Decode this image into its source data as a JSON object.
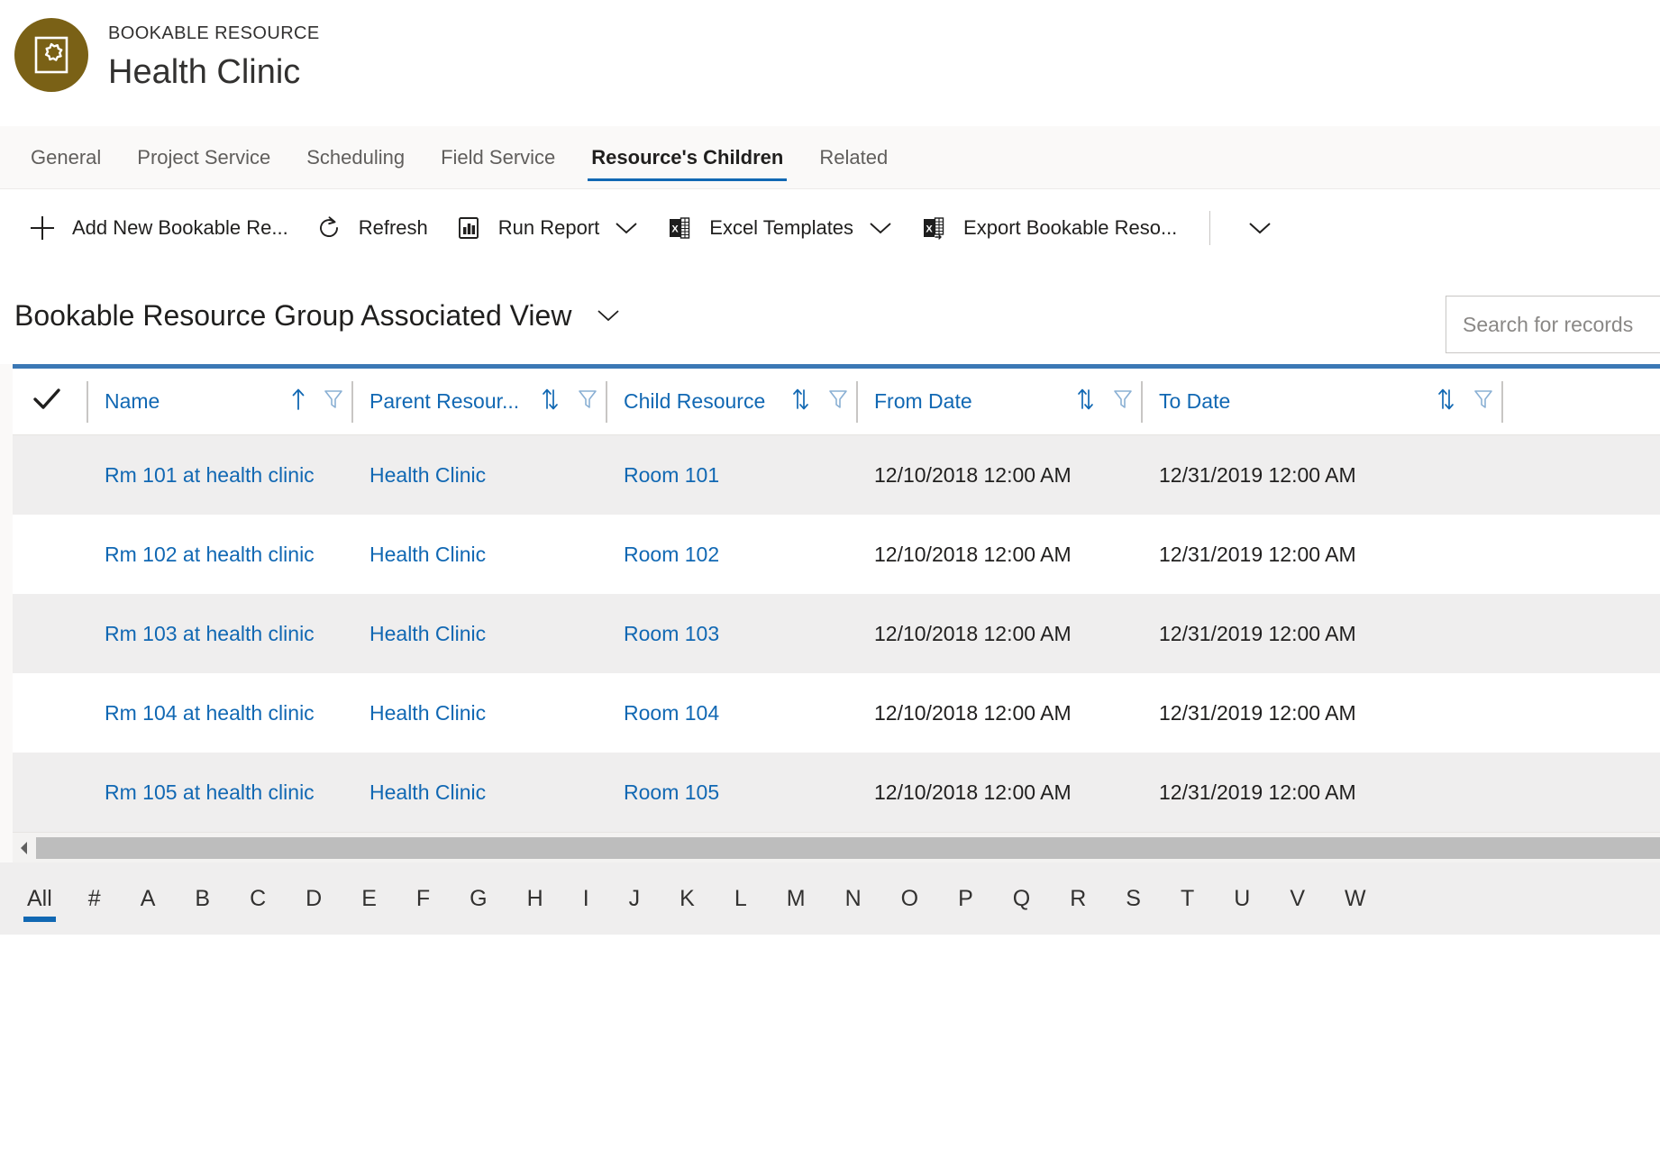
{
  "record": {
    "entity_label": "BOOKABLE RESOURCE",
    "title": "Health Clinic",
    "avatar_icon": "bookable-resource-icon",
    "avatar_color": "#7a6116"
  },
  "tabs": [
    {
      "label": "General",
      "active": false
    },
    {
      "label": "Project Service",
      "active": false
    },
    {
      "label": "Scheduling",
      "active": false
    },
    {
      "label": "Field Service",
      "active": false
    },
    {
      "label": "Resource's Children",
      "active": true
    },
    {
      "label": "Related",
      "active": false
    }
  ],
  "commandbar": {
    "items": [
      {
        "label": "Add New Bookable Re...",
        "icon": "plus-icon",
        "caret": false
      },
      {
        "label": "Refresh",
        "icon": "refresh-icon",
        "caret": false
      },
      {
        "label": "Run Report",
        "icon": "report-chart-icon",
        "caret": true
      },
      {
        "label": "Excel Templates",
        "icon": "excel-icon",
        "caret": true
      },
      {
        "label": "Export Bookable Reso...",
        "icon": "excel-export-icon",
        "caret": false
      }
    ],
    "overflow_icon": "chevron-down-icon"
  },
  "view": {
    "title": "Bookable Resource Group Associated View",
    "selector_icon": "chevron-down-icon"
  },
  "search": {
    "placeholder": "Search for records",
    "value": ""
  },
  "grid": {
    "accent_color": "#3b78b5",
    "link_color": "#1168b3",
    "select_all_icon": "checkmark-icon",
    "columns": [
      {
        "key": "name",
        "label": "Name",
        "sort": "asc",
        "filter": true
      },
      {
        "key": "parent",
        "label": "Parent Resour...",
        "sort": "none",
        "filter": true
      },
      {
        "key": "child",
        "label": "Child Resource",
        "sort": "none",
        "filter": true
      },
      {
        "key": "from",
        "label": "From Date",
        "sort": "none",
        "filter": true
      },
      {
        "key": "to",
        "label": "To Date",
        "sort": "none",
        "filter": true
      }
    ],
    "rows": [
      {
        "name": "Rm 101 at health clinic",
        "parent": "Health Clinic",
        "child": "Room 101",
        "from": "12/10/2018 12:00 AM",
        "to": "12/31/2019 12:00 AM"
      },
      {
        "name": "Rm 102 at health clinic",
        "parent": "Health Clinic",
        "child": "Room 102",
        "from": "12/10/2018 12:00 AM",
        "to": "12/31/2019 12:00 AM"
      },
      {
        "name": "Rm 103 at health clinic",
        "parent": "Health Clinic",
        "child": "Room 103",
        "from": "12/10/2018 12:00 AM",
        "to": "12/31/2019 12:00 AM"
      },
      {
        "name": "Rm 104 at health clinic",
        "parent": "Health Clinic",
        "child": "Room 104",
        "from": "12/10/2018 12:00 AM",
        "to": "12/31/2019 12:00 AM"
      },
      {
        "name": "Rm 105 at health clinic",
        "parent": "Health Clinic",
        "child": "Room 105",
        "from": "12/10/2018 12:00 AM",
        "to": "12/31/2019 12:00 AM"
      }
    ]
  },
  "alpha_index": {
    "selected": "All",
    "items": [
      "All",
      "#",
      "A",
      "B",
      "C",
      "D",
      "E",
      "F",
      "G",
      "H",
      "I",
      "J",
      "K",
      "L",
      "M",
      "N",
      "O",
      "P",
      "Q",
      "R",
      "S",
      "T",
      "U",
      "V",
      "W"
    ]
  }
}
